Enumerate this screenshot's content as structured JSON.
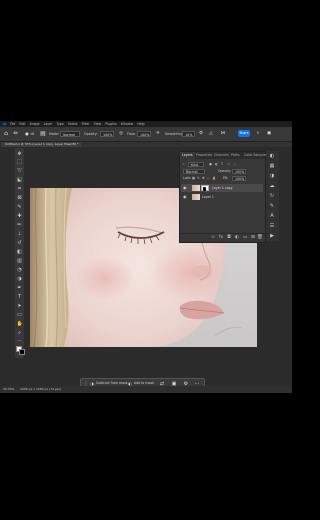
{
  "menubar": {
    "app_logo": "Ps",
    "items": [
      "File",
      "Edit",
      "Image",
      "Layer",
      "Type",
      "Select",
      "Filter",
      "View",
      "Plugins",
      "Window",
      "Help"
    ]
  },
  "options_bar": {
    "mode_label": "Mode:",
    "mode_value": "Normal",
    "opacity_label": "Opacity:",
    "opacity_value": "100%",
    "flow_label": "Flow:",
    "flow_value": "100%",
    "smoothing_label": "Smoothing:",
    "smoothing_value": "10%",
    "brush_size": "16",
    "share_label": "Share"
  },
  "document_tab": {
    "title": "Untitled-1 @ 33% (Layer 1 copy, Layer Mask/8) *"
  },
  "tools": [
    {
      "icon": "move-icon",
      "glyph": "✥"
    },
    {
      "icon": "marquee-icon",
      "glyph": "⬚"
    },
    {
      "icon": "lasso-icon",
      "glyph": "➰"
    },
    {
      "icon": "object-select-icon",
      "glyph": "⬕"
    },
    {
      "icon": "crop-icon",
      "glyph": "⌗"
    },
    {
      "icon": "frame-icon",
      "glyph": "⊠"
    },
    {
      "icon": "eyedropper-icon",
      "glyph": "✎"
    },
    {
      "icon": "healing-brush-icon",
      "glyph": "✚"
    },
    {
      "icon": "brush-icon",
      "glyph": "✏"
    },
    {
      "icon": "clone-stamp-icon",
      "glyph": "⊥"
    },
    {
      "icon": "history-brush-icon",
      "glyph": "↺"
    },
    {
      "icon": "eraser-icon",
      "glyph": "◧"
    },
    {
      "icon": "gradient-icon",
      "glyph": "▥"
    },
    {
      "icon": "blur-icon",
      "glyph": "◔"
    },
    {
      "icon": "dodge-icon",
      "glyph": "◑"
    },
    {
      "icon": "pen-icon",
      "glyph": "✒"
    },
    {
      "icon": "type-icon",
      "glyph": "T"
    },
    {
      "icon": "path-select-icon",
      "glyph": "➤"
    },
    {
      "icon": "rectangle-icon",
      "glyph": "▭"
    },
    {
      "icon": "hand-icon",
      "glyph": "✋"
    },
    {
      "icon": "zoom-icon",
      "glyph": "⌕"
    },
    {
      "icon": "more-tools-icon",
      "glyph": "⋯"
    }
  ],
  "panel": {
    "tabs": [
      "Layers",
      "Properties",
      "Channels",
      "Paths",
      "Color Sampler"
    ],
    "kind_label": "Kind",
    "blend_mode": "Normal",
    "opacity_label": "Opacity:",
    "opacity_value": "100%",
    "lock_label": "Lock:",
    "fill_label": "Fill:",
    "fill_value": "100%",
    "layers": [
      {
        "name": "Layer 1 copy",
        "selected": true
      },
      {
        "name": "Layer 1",
        "selected": false
      }
    ]
  },
  "status": {
    "zoom": "33.33%",
    "doc_info": "1000 px x 1500 px (72 ppi)"
  },
  "context_bar": {
    "subtract_label": "Subtract from mask",
    "add_label": "Add to mask"
  },
  "colors": {
    "accent": "#1473e6",
    "foreground": "#ffffff",
    "background": "#000000"
  }
}
